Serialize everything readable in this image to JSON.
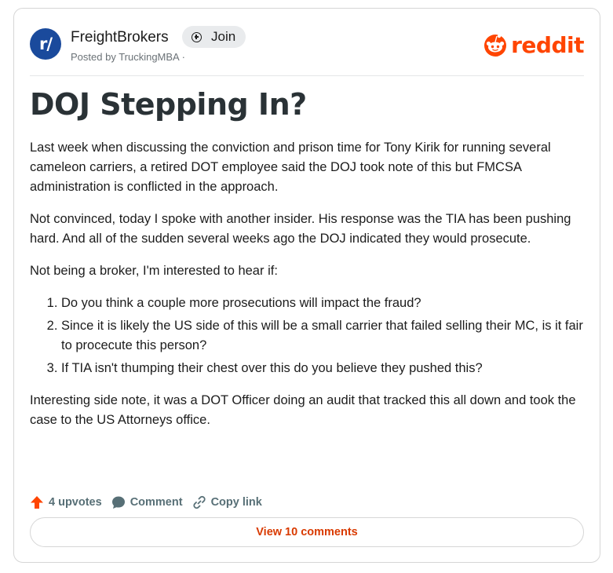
{
  "subreddit": {
    "avatar_text": "r/",
    "name": "FreightBrokers",
    "join_label": "Join",
    "posted_by": "Posted by TruckingMBA ·"
  },
  "brand": {
    "logo_text": "reddit",
    "color": "#ff4500"
  },
  "post": {
    "title": "DOJ Stepping In?",
    "paragraphs": [
      "Last week when discussing the conviction and prison time for Tony Kirik for running several cameleon carriers, a retired DOT employee said the DOJ took note of this but FMCSA administration is conflicted in the approach.",
      "Not convinced, today I spoke with another insider. His response was the TIA has been pushing hard. And all of the sudden several weeks ago the DOJ indicated they would prosecute.",
      "Not being a broker, I'm interested to hear if:"
    ],
    "questions": [
      "Do you think a couple more prosecutions will impact the fraud?",
      "Since it is likely the US side of this will be a small carrier that failed selling their MC, is it fair to procecute this person?",
      "If TIA isn't thumping their chest over this do you believe they pushed this?"
    ],
    "closing": "Interesting side note, it was a DOT Officer doing an audit that tracked this all down and took the case to the US Attorneys office."
  },
  "actions": {
    "upvotes": "4 upvotes",
    "comment": "Comment",
    "copy_link": "Copy link"
  },
  "view_comments": "View 10 comments"
}
